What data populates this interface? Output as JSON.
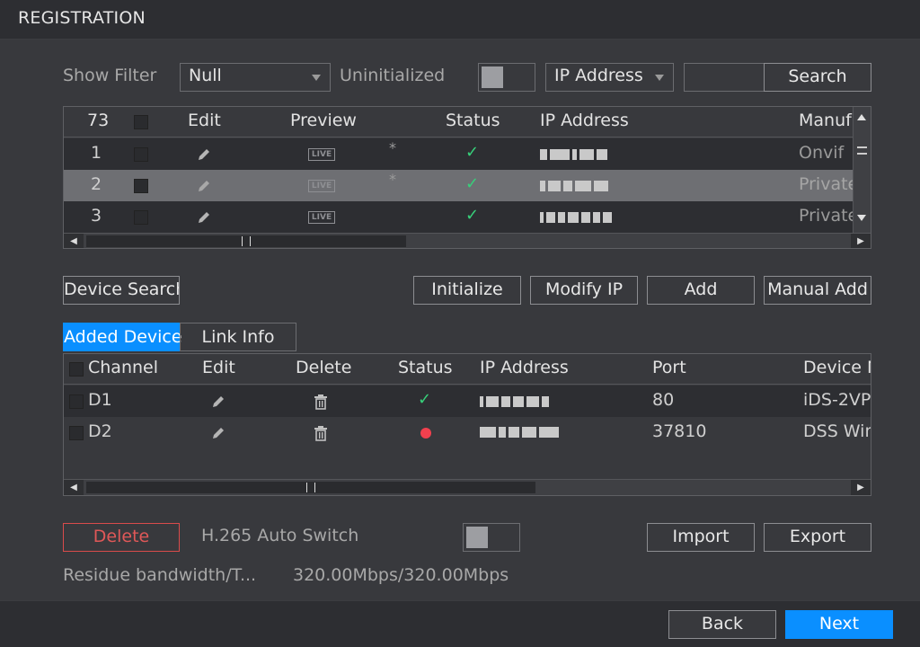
{
  "window": {
    "title": "REGISTRATION"
  },
  "filter": {
    "show_filter_label": "Show Filter",
    "show_filter_value": "Null",
    "uninitialized_label": "Uninitialized",
    "search_type_value": "IP Address",
    "search_input_value": "",
    "search_button": "Search"
  },
  "device_list": {
    "headers": {
      "count": "73",
      "edit": "Edit",
      "preview": "Preview",
      "status": "Status",
      "ip": "IP Address",
      "manufacturer": "Manuf"
    },
    "rows": [
      {
        "index": "1",
        "live": "LIVE",
        "star": "*",
        "manufacturer": "Onvif"
      },
      {
        "index": "2",
        "live": "LIVE",
        "star": "*",
        "manufacturer": "Private"
      },
      {
        "index": "3",
        "live": "LIVE",
        "star": "",
        "manufacturer": "Private"
      }
    ]
  },
  "actions": {
    "device_search": "Device Search",
    "initialize": "Initialize",
    "modify_ip": "Modify IP",
    "add": "Add",
    "manual_add": "Manual Add"
  },
  "tabs": {
    "added_device": "Added Device",
    "link_info": "Link Info"
  },
  "added_list": {
    "headers": {
      "channel": "Channel",
      "edit": "Edit",
      "delete": "Delete",
      "status": "Status",
      "ip": "IP Address",
      "port": "Port",
      "device_name": "Device N"
    },
    "rows": [
      {
        "channel": "D1",
        "port": "80",
        "device_name": "iDS-2VP"
      },
      {
        "channel": "D2",
        "port": "37810",
        "device_name": "DSS Win"
      }
    ]
  },
  "footer": {
    "delete_button": "Delete",
    "h265_label": "H.265 Auto Switch",
    "import_button": "Import",
    "export_button": "Export",
    "bandwidth_label": "Residue bandwidth/T...",
    "bandwidth_value": "320.00Mbps/320.00Mbps"
  },
  "nav": {
    "back": "Back",
    "next": "Next"
  },
  "colors": {
    "accent": "#0a8fff",
    "ok": "#37d07a",
    "error": "#f2404e",
    "danger_border": "#d94b4b"
  },
  "icons": [
    "pencil-icon",
    "live-icon",
    "check-icon",
    "trash-icon",
    "red-dot-icon",
    "caret-down-icon",
    "scroll-arrow-icon"
  ]
}
